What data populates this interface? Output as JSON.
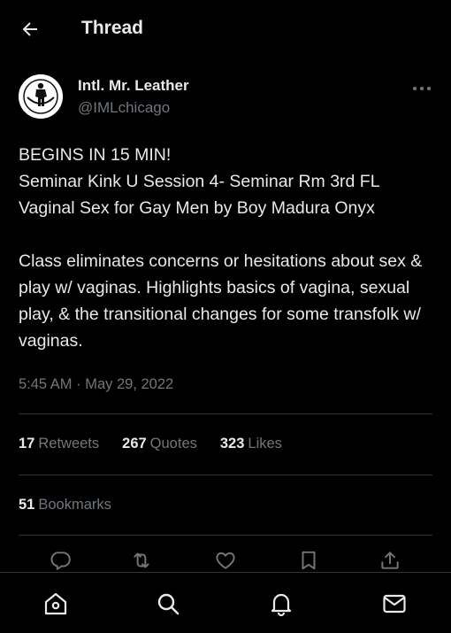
{
  "header": {
    "title": "Thread"
  },
  "tweet": {
    "author_name": "Intl. Mr. Leather",
    "author_handle": "@IMLchicago",
    "paragraph1": "BEGINS IN 15 MIN!\nSeminar Kink U Session 4- Seminar Rm 3rd FL\nVaginal Sex for Gay Men by Boy Madura Onyx",
    "paragraph2": "Class eliminates concerns or hesitations about sex & play w/ vaginas. Highlights basics of vagina, sexual play, & the transitional changes for some transfolk w/ vaginas.",
    "timestamp": "5:45 AM · May 29, 2022"
  },
  "stats": {
    "retweets_count": "17",
    "retweets_label": "Retweets",
    "quotes_count": "267",
    "quotes_label": "Quotes",
    "likes_count": "323",
    "likes_label": "Likes",
    "bookmarks_count": "51",
    "bookmarks_label": "Bookmarks"
  },
  "icons": {
    "back": "arrow-left-icon",
    "more": "more-horizontal-icon",
    "reply": "reply-icon",
    "retweet": "retweet-icon",
    "like": "heart-icon",
    "bookmark": "bookmark-icon",
    "share": "share-icon",
    "home": "home-icon",
    "search": "search-icon",
    "notifications": "bell-icon",
    "messages": "mail-icon"
  },
  "colors": {
    "background": "#000000",
    "text": "#e7e9ea",
    "secondary": "#71767b",
    "divider": "#2f3336"
  }
}
